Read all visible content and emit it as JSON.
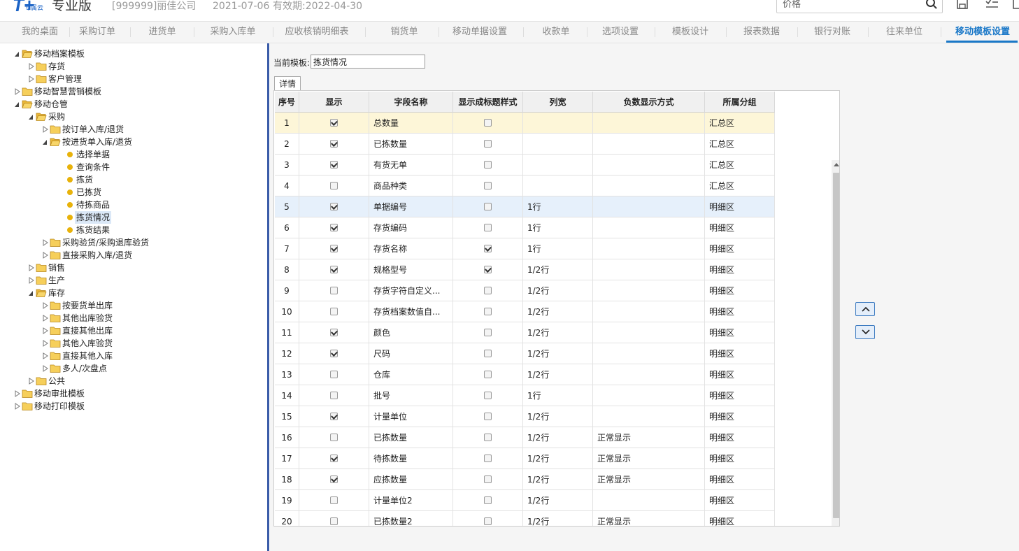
{
  "header": {
    "logo": "T+",
    "logo_sub": "专属云",
    "edition": "专业版",
    "company": "[999999]丽佳公司",
    "date": "2021-07-06",
    "validity": "有效期:2022-04-30",
    "search_placeholder": "价格"
  },
  "tabs": [
    {
      "label": "我的桌面"
    },
    {
      "label": "采购订单"
    },
    {
      "label": "进货单"
    },
    {
      "label": "采购入库单"
    },
    {
      "label": "应收核销明细表"
    },
    {
      "label": "销货单"
    },
    {
      "label": "移动单据设置"
    },
    {
      "label": "收款单"
    },
    {
      "label": "选项设置"
    },
    {
      "label": "模板设计"
    },
    {
      "label": "报表数据"
    },
    {
      "label": "银行对账"
    },
    {
      "label": "往来单位"
    },
    {
      "label": "移动模板设置",
      "active": true
    }
  ],
  "tree": [
    {
      "label": "移动档案模板",
      "type": "folder",
      "state": "open"
    },
    {
      "label": "存货",
      "type": "folder",
      "state": "closed"
    },
    {
      "label": "客户管理",
      "type": "folder",
      "state": "closed"
    },
    {
      "label": "移动智慧营销模板",
      "type": "folder",
      "state": "closed"
    },
    {
      "label": "移动仓管",
      "type": "folder",
      "state": "open"
    },
    {
      "label": "采购",
      "type": "folder",
      "state": "open"
    },
    {
      "label": "按订单入库/退货",
      "type": "folder",
      "state": "closed"
    },
    {
      "label": "按进货单入库/退货",
      "type": "folder",
      "state": "open"
    },
    {
      "label": "选择单据",
      "type": "leaf"
    },
    {
      "label": "查询条件",
      "type": "leaf"
    },
    {
      "label": "拣货",
      "type": "leaf"
    },
    {
      "label": "已拣货",
      "type": "leaf"
    },
    {
      "label": "待拣商品",
      "type": "leaf"
    },
    {
      "label": "拣货情况",
      "type": "leaf",
      "selected": true
    },
    {
      "label": "拣货结果",
      "type": "leaf"
    },
    {
      "label": "采购验货/采购退库验货",
      "type": "folder",
      "state": "closed"
    },
    {
      "label": "直接采购入库/退货",
      "type": "folder",
      "state": "closed"
    },
    {
      "label": "销售",
      "type": "folder",
      "state": "closed"
    },
    {
      "label": "生产",
      "type": "folder",
      "state": "closed"
    },
    {
      "label": "库存",
      "type": "folder",
      "state": "open"
    },
    {
      "label": "按要货单出库",
      "type": "folder",
      "state": "closed"
    },
    {
      "label": "其他出库验货",
      "type": "folder",
      "state": "closed"
    },
    {
      "label": "直接其他出库",
      "type": "folder",
      "state": "closed"
    },
    {
      "label": "其他入库验货",
      "type": "folder",
      "state": "closed"
    },
    {
      "label": "直接其他入库",
      "type": "folder",
      "state": "closed"
    },
    {
      "label": "多人/次盘点",
      "type": "folder",
      "state": "closed"
    },
    {
      "label": "公共",
      "type": "folder",
      "state": "closed"
    },
    {
      "label": "移动审批模板",
      "type": "folder",
      "state": "closed"
    },
    {
      "label": "移动打印模板",
      "type": "folder",
      "state": "closed"
    }
  ],
  "template": {
    "label": "当前模板:",
    "value": "拣货情况",
    "detail_tab": "详情"
  },
  "grid": {
    "headers": [
      "序号",
      "显示",
      "字段名称",
      "显示成标题样式",
      "列宽",
      "负数显示方式",
      "所属分组"
    ],
    "rows": [
      {
        "no": "1",
        "show": true,
        "field": "总数量",
        "title_style": false,
        "width": "",
        "negative": "",
        "group": "汇总区"
      },
      {
        "no": "2",
        "show": true,
        "field": "已拣数量",
        "title_style": false,
        "width": "",
        "negative": "",
        "group": "汇总区"
      },
      {
        "no": "3",
        "show": true,
        "field": "有货无单",
        "title_style": false,
        "width": "",
        "negative": "",
        "group": "汇总区"
      },
      {
        "no": "4",
        "show": false,
        "field": "商品种类",
        "title_style": false,
        "width": "",
        "negative": "",
        "group": "汇总区"
      },
      {
        "no": "5",
        "show": true,
        "field": "单据编号",
        "title_style": false,
        "width": "1行",
        "negative": "",
        "group": "明细区"
      },
      {
        "no": "6",
        "show": true,
        "field": "存货编码",
        "title_style": false,
        "width": "1行",
        "negative": "",
        "group": "明细区"
      },
      {
        "no": "7",
        "show": true,
        "field": "存货名称",
        "title_style": true,
        "width": "1行",
        "negative": "",
        "group": "明细区"
      },
      {
        "no": "8",
        "show": true,
        "field": "规格型号",
        "title_style": true,
        "width": "1/2行",
        "negative": "",
        "group": "明细区"
      },
      {
        "no": "9",
        "show": false,
        "field": "存货字符自定义...",
        "title_style": false,
        "width": "1/2行",
        "negative": "",
        "group": "明细区"
      },
      {
        "no": "10",
        "show": false,
        "field": "存货档案数值自...",
        "title_style": false,
        "width": "1/2行",
        "negative": "",
        "group": "明细区"
      },
      {
        "no": "11",
        "show": true,
        "field": "颜色",
        "title_style": false,
        "width": "1/2行",
        "negative": "",
        "group": "明细区"
      },
      {
        "no": "12",
        "show": true,
        "field": "尺码",
        "title_style": false,
        "width": "1/2行",
        "negative": "",
        "group": "明细区"
      },
      {
        "no": "13",
        "show": false,
        "field": "仓库",
        "title_style": false,
        "width": "1/2行",
        "negative": "",
        "group": "明细区"
      },
      {
        "no": "14",
        "show": false,
        "field": "批号",
        "title_style": false,
        "width": "1行",
        "negative": "",
        "group": "明细区"
      },
      {
        "no": "15",
        "show": true,
        "field": "计量单位",
        "title_style": false,
        "width": "1/2行",
        "negative": "",
        "group": "明细区"
      },
      {
        "no": "16",
        "show": false,
        "field": "已拣数量",
        "title_style": false,
        "width": "1/2行",
        "negative": "正常显示",
        "group": "明细区"
      },
      {
        "no": "17",
        "show": true,
        "field": "待拣数量",
        "title_style": false,
        "width": "1/2行",
        "negative": "正常显示",
        "group": "明细区"
      },
      {
        "no": "18",
        "show": true,
        "field": "应拣数量",
        "title_style": false,
        "width": "1/2行",
        "negative": "正常显示",
        "group": "明细区"
      },
      {
        "no": "19",
        "show": false,
        "field": "计量单位2",
        "title_style": false,
        "width": "1/2行",
        "negative": "",
        "group": "明细区"
      },
      {
        "no": "20",
        "show": false,
        "field": "已拣数量2",
        "title_style": false,
        "width": "1/2行",
        "negative": "正常显示",
        "group": "明细区"
      }
    ]
  },
  "colors": {
    "accent": "#1a78c8",
    "selected_row": "#fdf6d8",
    "hover_row": "#e6f0fb",
    "folder": "#f2c94c",
    "splitter": "#3a5ca8"
  }
}
